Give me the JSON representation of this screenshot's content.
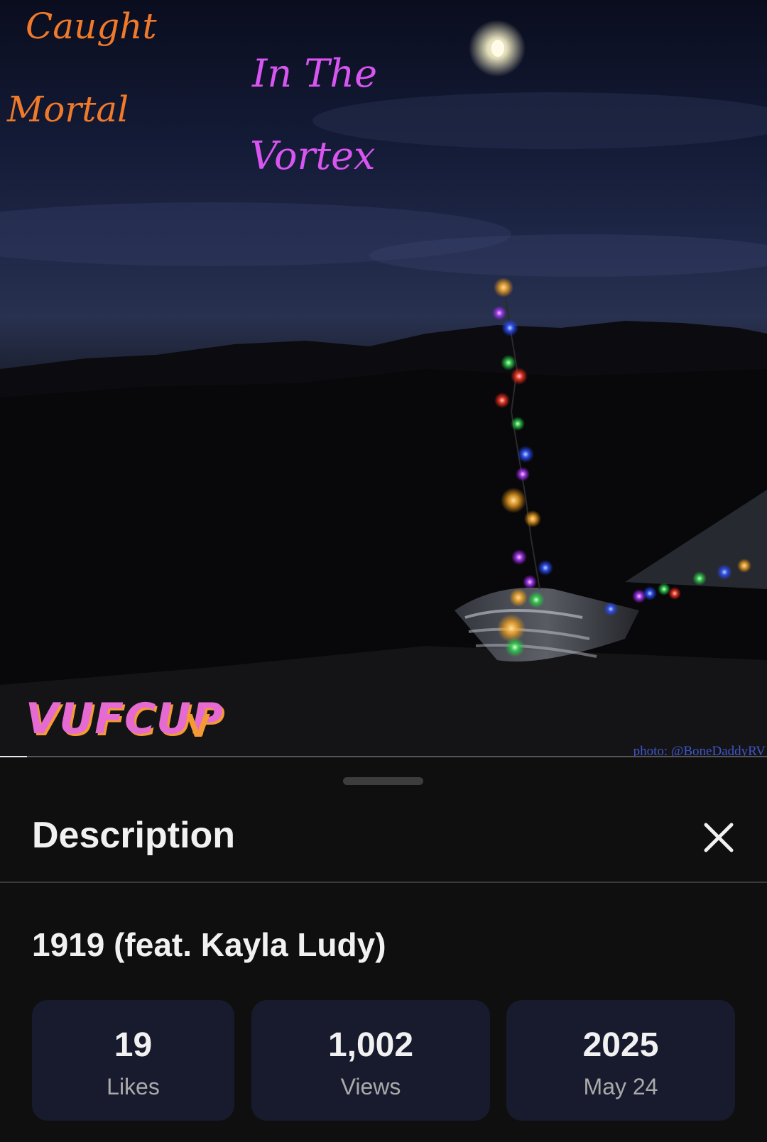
{
  "cover": {
    "line1": "Caught",
    "line2": "In The",
    "line3": "Mortal",
    "line4": "Vortex",
    "logo_text": "VUFCUP",
    "logo_mark": "V",
    "photo_credit": "photo: @BoneDaddyRV"
  },
  "player": {
    "progress_fraction": 0.035
  },
  "description_sheet": {
    "title": "Description",
    "close_icon": "close-icon",
    "song_title": "1919 (feat. Kayla Ludy)",
    "stats": [
      {
        "value": "19",
        "label": "Likes"
      },
      {
        "value": "1,002",
        "label": "Views"
      },
      {
        "value": "2025",
        "label": "May 24"
      }
    ]
  }
}
